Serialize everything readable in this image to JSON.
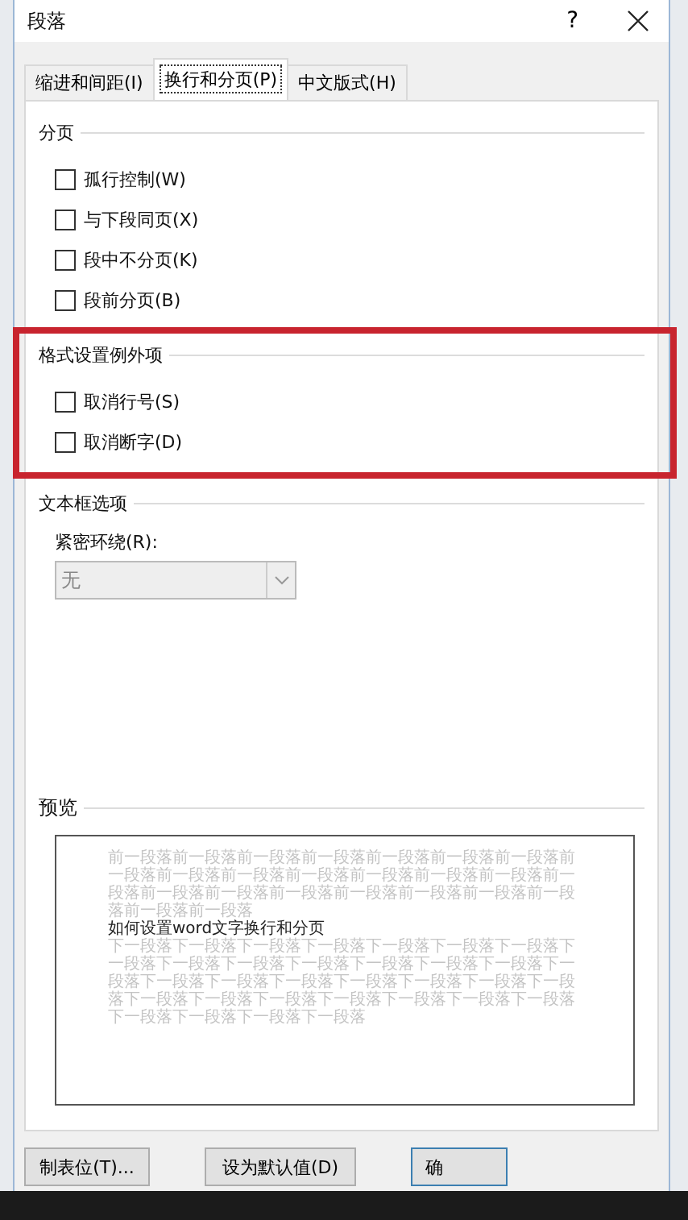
{
  "window": {
    "title": "段落",
    "help": "?"
  },
  "tabs": [
    {
      "label": "缩进和间距(I)",
      "selected": false
    },
    {
      "label": "换行和分页(P)",
      "selected": true
    },
    {
      "label": "中文版式(H)",
      "selected": false
    }
  ],
  "sections": [
    {
      "title": "分页",
      "highlighted": false,
      "options": [
        {
          "label": "孤行控制(W)",
          "checked": false
        },
        {
          "label": "与下段同页(X)",
          "checked": false
        },
        {
          "label": "段中不分页(K)",
          "checked": false
        },
        {
          "label": "段前分页(B)",
          "checked": false
        }
      ]
    },
    {
      "title": "格式设置例外项",
      "highlighted": true,
      "options": [
        {
          "label": "取消行号(S)",
          "checked": false
        },
        {
          "label": "取消断字(D)",
          "checked": false
        }
      ]
    }
  ],
  "textbox_options": {
    "title": "文本框选项",
    "field_label": "紧密环绕(R):",
    "select": {
      "value": "无",
      "disabled": true
    }
  },
  "preview": {
    "title": "预览",
    "previous_text": "前一段落前一段落前一段落前一段落前一段落前一段落前一段落前一段落前一段落前一段落前一段落前一段落前一段落前一段落前一段落前一段落前一段落前一段落前一段落前一段落前一段落前一段落前一段落前一段落",
    "sample_text": "如何设置word文字换行和分页",
    "next_text": "下一段落下一段落下一段落下一段落下一段落下一段落下一段落下一段落下一段落下一段落下一段落下一段落下一段落下一段落下一段落下一段落下一段落下一段落下一段落下一段落下一段落下一段落下一段落下一段落下一段落下一段落下一段落下一段落下一段落下一段落下一段落下一段落下一段落"
  },
  "buttons": [
    {
      "label": "制表位(T)..."
    },
    {
      "label": "设为默认值(D)"
    },
    {
      "label": "确"
    }
  ]
}
